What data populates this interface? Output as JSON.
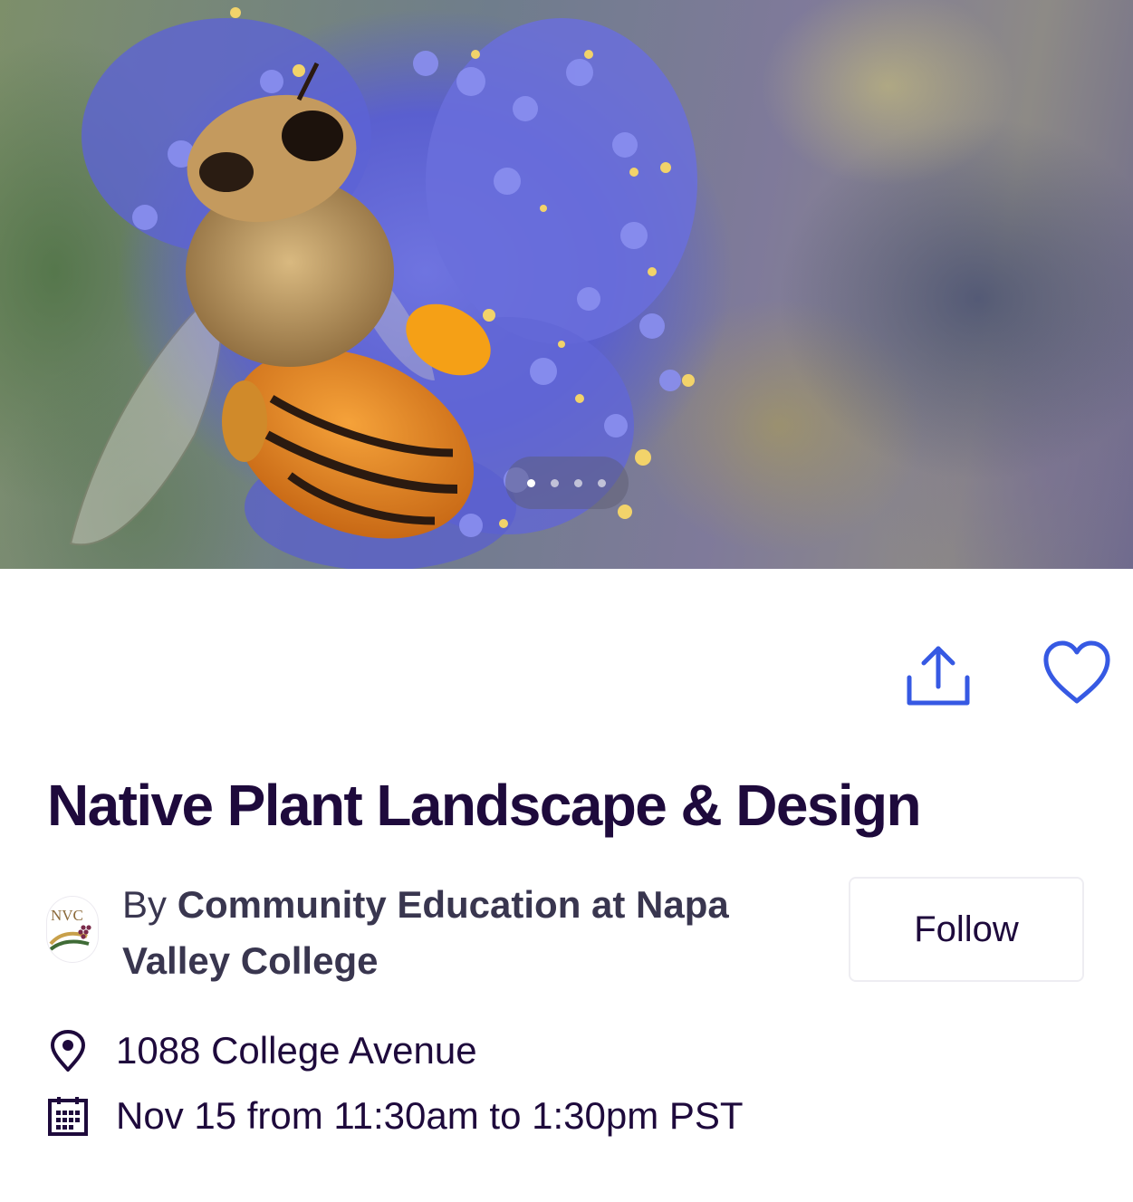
{
  "hero": {
    "image": "bee-on-ceanothus-photo",
    "carousel": {
      "total_slides": 4,
      "active_index": 0
    }
  },
  "actions": {
    "share_icon": "share-icon",
    "like_icon": "heart-icon",
    "accent_color": "#3659e3"
  },
  "event": {
    "title": "Native Plant Landscape & Design",
    "title_color": "#1e0a3c"
  },
  "organizer": {
    "by_label": "By",
    "name": "Community Education at Napa Valley College",
    "logo_text": "NVC",
    "follow_label": "Follow"
  },
  "details": {
    "location_icon": "map-pin-icon",
    "location": "1088 College Avenue",
    "date_icon": "calendar-icon",
    "datetime": "Nov 15 from 11:30am to 1:30pm PST"
  }
}
